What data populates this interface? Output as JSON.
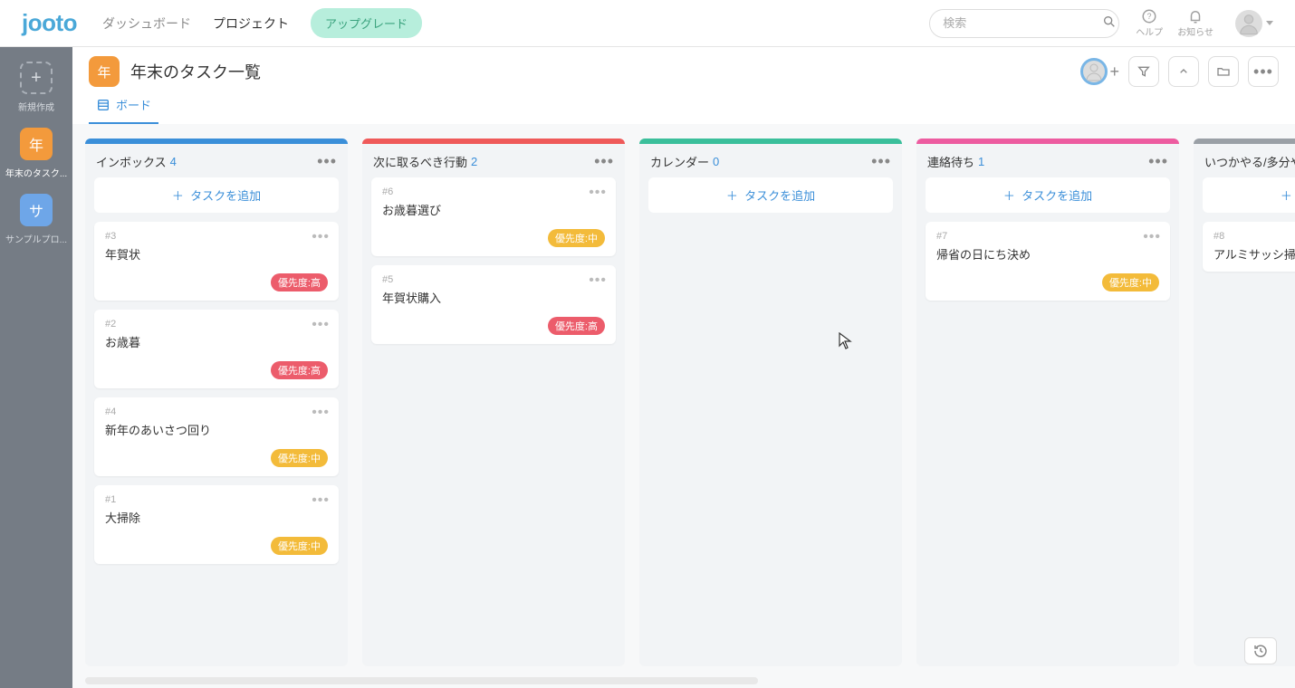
{
  "header": {
    "logo": "jooto",
    "nav": {
      "dashboard": "ダッシュボード",
      "project": "プロジェクト",
      "upgrade": "アップグレード"
    },
    "search_placeholder": "検索",
    "help_label": "ヘルプ",
    "notifications_label": "お知らせ"
  },
  "sidebar": {
    "new_label": "新規作成",
    "items": [
      {
        "tile": "年",
        "label": "年末のタスク...",
        "active": true,
        "color": "orange"
      },
      {
        "tile": "サ",
        "label": "サンプルプロ...",
        "active": false,
        "color": "blue"
      }
    ]
  },
  "project": {
    "tile": "年",
    "title": "年末のタスク一覧",
    "tab_board": "ボード"
  },
  "add_task_label": "タスクを追加",
  "priority_labels": {
    "high": "優先度:高",
    "mid": "優先度:中"
  },
  "lists": [
    {
      "id": "inbox",
      "title": "インボックス",
      "count": 4,
      "color": "#3b8fd9",
      "show_add_button": true,
      "cards": [
        {
          "id": "#3",
          "title": "年賀状",
          "priority": "high"
        },
        {
          "id": "#2",
          "title": "お歳暮",
          "priority": "high"
        },
        {
          "id": "#4",
          "title": "新年のあいさつ回り",
          "priority": "mid"
        },
        {
          "id": "#1",
          "title": "大掃除",
          "priority": "mid"
        }
      ]
    },
    {
      "id": "next",
      "title": "次に取るべき行動",
      "count": 2,
      "color": "#ef5a5a",
      "show_add_button": false,
      "cards": [
        {
          "id": "#6",
          "title": "お歳暮選び",
          "priority": "mid"
        },
        {
          "id": "#5",
          "title": "年賀状購入",
          "priority": "high"
        }
      ]
    },
    {
      "id": "calendar",
      "title": "カレンダー",
      "count": 0,
      "color": "#3bbf9b",
      "show_add_button": true,
      "cards": []
    },
    {
      "id": "waiting",
      "title": "連絡待ち",
      "count": 1,
      "color": "#ed5ca0",
      "show_add_button": true,
      "cards": [
        {
          "id": "#7",
          "title": "帰省の日にち決め",
          "priority": "mid"
        }
      ]
    },
    {
      "id": "someday",
      "title": "いつかやる/多分や",
      "count": null,
      "color": "#9aa0a6",
      "show_add_button": true,
      "cards": [
        {
          "id": "#8",
          "title": "アルミサッシ掃除",
          "priority": null
        }
      ]
    }
  ]
}
